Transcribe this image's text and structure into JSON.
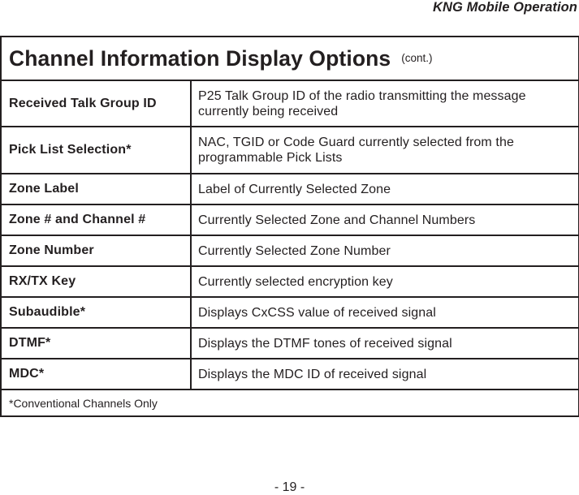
{
  "header": {
    "running_title": "KNG Mobile Operation"
  },
  "table": {
    "title": "Channel Information Display Options",
    "title_suffix": "(cont.)",
    "rows": [
      {
        "label": "Received Talk Group ID",
        "description": "P25 Talk Group ID of the radio transmitting the message currently being received"
      },
      {
        "label": "Pick List Selection*",
        "description": "NAC, TGID or Code Guard currently selected from the programmable Pick Lists"
      },
      {
        "label": "Zone Label",
        "description": "Label of Currently Selected Zone"
      },
      {
        "label": "Zone # and Channel #",
        "description": "Currently Selected Zone and Channel Numbers"
      },
      {
        "label": "Zone Number",
        "description": "Currently Selected Zone Number"
      },
      {
        "label": "RX/TX Key",
        "description": "Currently selected encryption key"
      },
      {
        "label": "Subaudible*",
        "description": "Displays CxCSS value of received signal"
      },
      {
        "label": "DTMF*",
        "description": "Displays the DTMF tones of received signal"
      },
      {
        "label": "MDC*",
        "description": "Displays the MDC ID of received signal"
      }
    ],
    "footnote": "*Conventional Channels Only"
  },
  "footer": {
    "page_number": "- 19 -"
  }
}
